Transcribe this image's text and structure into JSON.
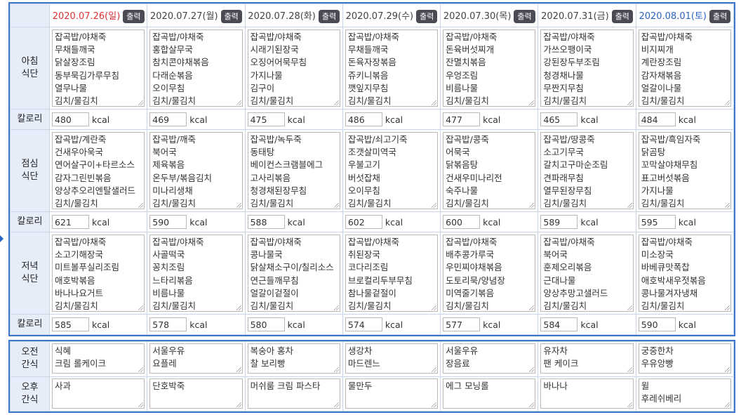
{
  "output_label": "출력",
  "kcal_unit": "kcal",
  "row_labels": {
    "breakfast": [
      "아침",
      "식단"
    ],
    "lunch": [
      "점심",
      "식단"
    ],
    "dinner": [
      "저녁",
      "식단"
    ],
    "calorie": "칼로리",
    "am_snack": [
      "오전",
      "간식"
    ],
    "pm_snack": [
      "오후",
      "간식"
    ]
  },
  "days": [
    {
      "date": "2020.07.26(일)",
      "type": "sun",
      "breakfast": [
        "잡곡밥/야채죽",
        "무채들깨국",
        "닭살장조림",
        "동부묵김가루무침",
        "열무나물",
        "김치/물김치"
      ],
      "breakfast_kcal": "480",
      "lunch": [
        "잡곡밥/계란죽",
        "건새우아욱국",
        "연어살구이+타르소스",
        "감자그린빈볶음",
        "양상추오리엔탈샐러드",
        "김치/물김치"
      ],
      "lunch_kcal": "621",
      "dinner": [
        "잡곡밥/야채죽",
        "소고기해장국",
        "미트볼푸실리조림",
        "애호박볶음",
        "바나나요거트",
        "김치/물김치"
      ],
      "dinner_kcal": "585",
      "am_snack": [
        "식혜",
        "크림 롤케이크"
      ],
      "pm_snack": [
        "사과"
      ]
    },
    {
      "date": "2020.07.27(월)",
      "type": "week",
      "breakfast": [
        "잡곡밥/야채죽",
        "홍합살무국",
        "참치콘야채볶음",
        "다래순볶음",
        "오이무침",
        "김치/물김치"
      ],
      "breakfast_kcal": "469",
      "lunch": [
        "잡곡밥/깨죽",
        "북어국",
        "제육볶음",
        "온두부/볶음김치",
        "미나리생채",
        "김치/물김치"
      ],
      "lunch_kcal": "590",
      "dinner": [
        "잡곡밥/야채죽",
        "사골떡국",
        "꽁치조림",
        "느타리볶음",
        "비름나물",
        "김치/물김치"
      ],
      "dinner_kcal": "578",
      "am_snack": [
        "서울우유",
        "요플레"
      ],
      "pm_snack": [
        "단호박죽"
      ]
    },
    {
      "date": "2020.07.28(화)",
      "type": "week",
      "breakfast": [
        "잡곡밥/야채죽",
        "시래기된장국",
        "오징어어묵무침",
        "가지나물",
        "김구이",
        "김치/물김치"
      ],
      "breakfast_kcal": "475",
      "lunch": [
        "잡곡밥/녹두죽",
        "동태탕",
        "베이컨스크램블에그",
        "고사리볶음",
        "청경채된장무침",
        "김치/물김치"
      ],
      "lunch_kcal": "588",
      "dinner": [
        "잡곡밥/야채죽",
        "콩나물국",
        "닭살채소구이/칠리소스",
        "연근들깨무침",
        "얼갈이겉절이",
        "김치/물김치"
      ],
      "dinner_kcal": "580",
      "am_snack": [
        "복숭아 홍차",
        "찰 보리빵"
      ],
      "pm_snack": [
        "머쉬룸 크림 파스타"
      ]
    },
    {
      "date": "2020.07.29(수)",
      "type": "week",
      "breakfast": [
        "잡곡밥/야채죽",
        "무채들깨국",
        "돈육자장볶음",
        "쥬키니볶음",
        "깻잎지무침",
        "김치/물김치"
      ],
      "breakfast_kcal": "486",
      "lunch": [
        "잡곡밥/쇠고기죽",
        "조갯살미역국",
        "우불고기",
        "버섯잡채",
        "오이무침",
        "김치/물김치"
      ],
      "lunch_kcal": "602",
      "dinner": [
        "잡곡밥/야채죽",
        "취된장국",
        "코다리조림",
        "브로컬리두부무침",
        "참나물겉절이",
        "김치/물김치"
      ],
      "dinner_kcal": "574",
      "am_snack": [
        "생강차",
        "마드렌느"
      ],
      "pm_snack": [
        "물만두"
      ]
    },
    {
      "date": "2020.07.30(목)",
      "type": "week",
      "breakfast": [
        "잡곡밥/야채죽",
        "돈육버섯찌개",
        "잔멸치볶음",
        "우엉조림",
        "비름나물",
        "김치/물김치"
      ],
      "breakfast_kcal": "477",
      "lunch": [
        "잡곡밥/콩죽",
        "어묵국",
        "닭볶음탕",
        "건새우미나리전",
        "숙주나물",
        "김치/물김치"
      ],
      "lunch_kcal": "600",
      "dinner": [
        "잡곡밥/야채죽",
        "배추콩가루국",
        "우민찌야채볶음",
        "도토리묵/양념장",
        "미역줄기볶음",
        "김치/물김치"
      ],
      "dinner_kcal": "577",
      "am_snack": [
        "서울우유",
        "장음료"
      ],
      "pm_snack": [
        "에그 모닝롤"
      ]
    },
    {
      "date": "2020.07.31(금)",
      "type": "week",
      "breakfast": [
        "잡곡밥/야채죽",
        "가쓰오팽이국",
        "강된장두부조림",
        "청경채나물",
        "무짠지무침",
        "김치/물김치"
      ],
      "breakfast_kcal": "465",
      "lunch": [
        "잡곡밥/땅콩죽",
        "소고기무국",
        "갈치고구마순조림",
        "견파래무침",
        "열무된장무침",
        "김치/물김치"
      ],
      "lunch_kcal": "589",
      "dinner": [
        "잡곡밥/야채죽",
        "북어국",
        "훈제오리볶음",
        "근대나물",
        "양상추망고샐러드",
        "김치/물김치"
      ],
      "dinner_kcal": "584",
      "am_snack": [
        "유자차",
        "팬 케이크"
      ],
      "pm_snack": [
        "바나나"
      ]
    },
    {
      "date": "2020.08.01(토)",
      "type": "sat",
      "breakfast": [
        "잡곡밥/야채죽",
        "비지찌개",
        "계란장조림",
        "감자채볶음",
        "얼갈이나물",
        "김치/물김치"
      ],
      "breakfast_kcal": "484",
      "lunch": [
        "잡곡밥/흑임자죽",
        "닭곰탕",
        "꼬막살야채무침",
        "표고버섯볶음",
        "가지나물",
        "김치/물김치"
      ],
      "lunch_kcal": "595",
      "dinner": [
        "잡곡밥/야채죽",
        "미소장국",
        "바베큐맛폭찹",
        "애호박새우젓볶음",
        "콩나물겨자냉채",
        "김치/물김치"
      ],
      "dinner_kcal": "590",
      "am_snack": [
        "궁중한차",
        "우유앙빵"
      ],
      "pm_snack": [
        "윌",
        "후레쉬베리"
      ]
    }
  ]
}
